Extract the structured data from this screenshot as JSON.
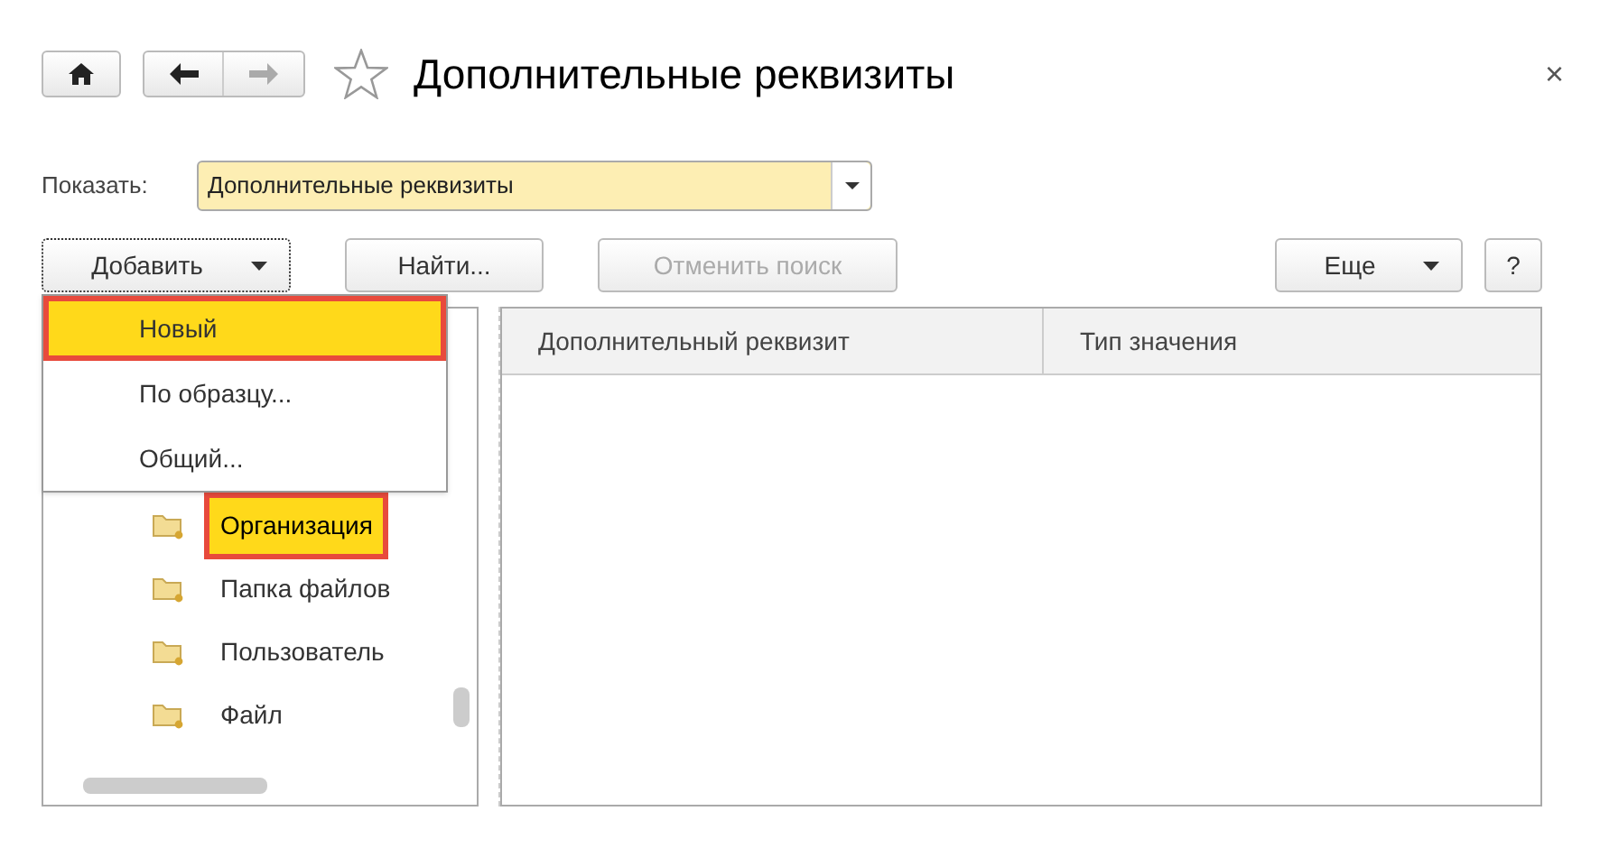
{
  "window": {
    "title": "Дополнительные реквизиты",
    "close": "×"
  },
  "show": {
    "label": "Показать:",
    "value": "Дополнительные реквизиты"
  },
  "toolbar": [
    {
      "label": "Добавить",
      "kind": "menu",
      "disabled": false,
      "focused": true
    },
    {
      "label": "Найти...",
      "kind": "plain",
      "disabled": false,
      "focused": false
    },
    {
      "label": "Отменить поиск",
      "kind": "plain",
      "disabled": true,
      "focused": false
    }
  ],
  "toolbar_right": [
    {
      "label": "Еще",
      "kind": "menu"
    },
    {
      "label": "?",
      "kind": "plain"
    }
  ],
  "add_menu": [
    {
      "label": "Новый",
      "selected": true,
      "highlighted": true
    },
    {
      "label": "По образцу...",
      "selected": false,
      "highlighted": false
    },
    {
      "label": "Общий...",
      "selected": false,
      "highlighted": false
    }
  ],
  "tree": [
    {
      "label": "Организация",
      "selected": true,
      "highlighted": true
    },
    {
      "label": "Папка файлов",
      "selected": false,
      "highlighted": false
    },
    {
      "label": "Пользователь",
      "selected": false,
      "highlighted": false
    },
    {
      "label": "Файл",
      "selected": false,
      "highlighted": false
    }
  ],
  "table": {
    "columns": [
      "Дополнительный реквизит",
      "Тип значения"
    ]
  }
}
